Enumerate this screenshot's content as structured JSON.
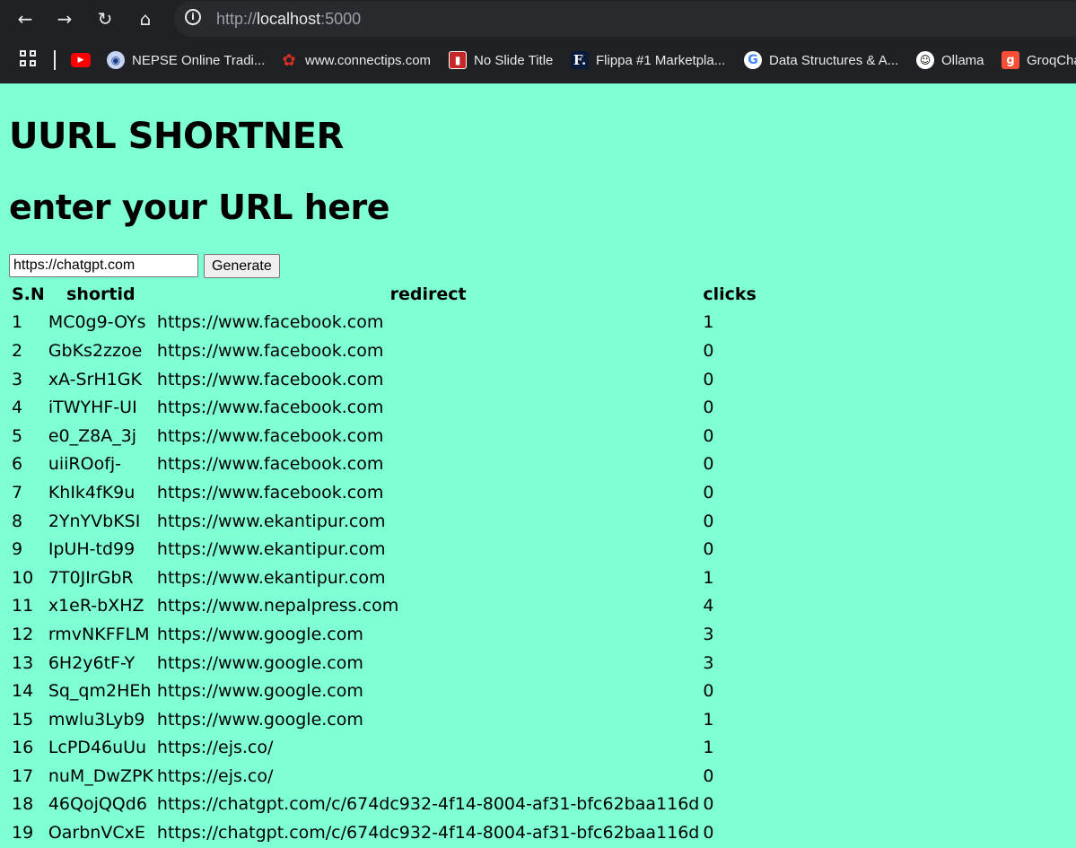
{
  "browser": {
    "url_scheme": "http://",
    "url_host": "localhost",
    "url_port": ":5000",
    "bookmarks": [
      {
        "label": "",
        "icon": "youtube-icon",
        "color": "#ff0000"
      },
      {
        "label": "NEPSE Online Tradi...",
        "icon": "nepse-icon",
        "color": "#c5d4f0"
      },
      {
        "label": "www.connectips.com",
        "icon": "connectips-icon",
        "color": "#d93025"
      },
      {
        "label": "No Slide Title",
        "icon": "slide-icon",
        "color": "#c62828"
      },
      {
        "label": "Flippa #1 Marketpla...",
        "icon": "flippa-icon",
        "color": "#0b1a3a"
      },
      {
        "label": "Data Structures & A...",
        "icon": "google-icon",
        "color": "#ffffff"
      },
      {
        "label": "Ollama",
        "icon": "ollama-icon",
        "color": "#ffffff"
      },
      {
        "label": "GroqCha",
        "icon": "groq-icon",
        "color": "#f55036"
      }
    ]
  },
  "page": {
    "title": "UURL SHORTNER",
    "subtitle": "enter your URL here",
    "input_value": "https://chatgpt.com",
    "button_label": "Generate",
    "table": {
      "headers": [
        "S.N",
        "shortid",
        "redirect",
        "clicks"
      ],
      "rows": [
        [
          "1",
          "MC0g9-OYs",
          "https://www.facebook.com",
          "1"
        ],
        [
          "2",
          "GbKs2zzoe",
          "https://www.facebook.com",
          "0"
        ],
        [
          "3",
          "xA-SrH1GK",
          "https://www.facebook.com",
          "0"
        ],
        [
          "4",
          "iTWYHF-UI",
          "https://www.facebook.com",
          "0"
        ],
        [
          "5",
          "e0_Z8A_3j",
          "https://www.facebook.com",
          "0"
        ],
        [
          "6",
          "uiiROofj-",
          "https://www.facebook.com",
          "0"
        ],
        [
          "7",
          "KhIk4fK9u",
          "https://www.facebook.com",
          "0"
        ],
        [
          "8",
          "2YnYVbKSI",
          "https://www.ekantipur.com",
          "0"
        ],
        [
          "9",
          "IpUH-td99",
          "https://www.ekantipur.com",
          "0"
        ],
        [
          "10",
          "7T0JIrGbR",
          "https://www.ekantipur.com",
          "1"
        ],
        [
          "11",
          "x1eR-bXHZ",
          "https://www.nepalpress.com",
          "4"
        ],
        [
          "12",
          "rmvNKFFLM",
          "https://www.google.com",
          "3"
        ],
        [
          "13",
          "6H2y6tF-Y",
          "https://www.google.com",
          "3"
        ],
        [
          "14",
          "Sq_qm2HEh",
          "https://www.google.com",
          "0"
        ],
        [
          "15",
          "mwlu3Lyb9",
          "https://www.google.com",
          "1"
        ],
        [
          "16",
          "LcPD46uUu",
          "https://ejs.co/",
          "1"
        ],
        [
          "17",
          "nuM_DwZPK",
          "https://ejs.co/",
          "0"
        ],
        [
          "18",
          "46QojQQd6",
          "https://chatgpt.com/c/674dc932-4f14-8004-af31-bfc62baa116d",
          "0"
        ],
        [
          "19",
          "OarbnVCxE",
          "https://chatgpt.com/c/674dc932-4f14-8004-af31-bfc62baa116d",
          "0"
        ]
      ]
    }
  },
  "colors": {
    "page_background": "#7fffd4",
    "chrome_background": "#202124"
  }
}
